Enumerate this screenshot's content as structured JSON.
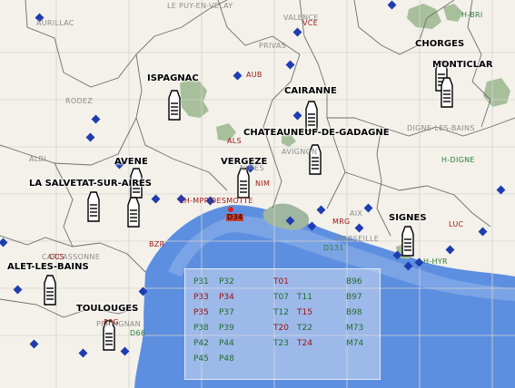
{
  "region_labels": [
    {
      "id": "gray-aurillac",
      "text": "AURILLAC",
      "style": "gray"
    },
    {
      "id": "gray-lepuy",
      "text": "LE PUY-EN-VELAY",
      "style": "gray"
    },
    {
      "id": "gray-valence",
      "text": "VALENCE",
      "style": "gray"
    },
    {
      "id": "gray-privas",
      "text": "PRIVAS",
      "style": "gray"
    },
    {
      "id": "gray-rodez",
      "text": "RODEZ",
      "style": "gray"
    },
    {
      "id": "gray-albi",
      "text": "ALBI",
      "style": "gray"
    },
    {
      "id": "gray-nimes",
      "text": "NIMES",
      "style": "gray"
    },
    {
      "id": "gray-avignon",
      "text": "AVIGNON",
      "style": "gray"
    },
    {
      "id": "gray-digne",
      "text": "DIGNE-LES-BAINS",
      "style": "gray"
    },
    {
      "id": "gray-aix",
      "text": "AIX",
      "style": "gray"
    },
    {
      "id": "gray-marseille",
      "text": "MARSEILLE",
      "style": "gray"
    },
    {
      "id": "gray-carcassonne",
      "text": "CARCASSONNE",
      "style": "gray"
    },
    {
      "id": "gray-perpignan",
      "text": "PERPIGNAN",
      "style": "gray"
    },
    {
      "id": "red-vce",
      "text": "VCE",
      "style": "red"
    },
    {
      "id": "red-aub",
      "text": "AUB",
      "style": "red"
    },
    {
      "id": "red-als",
      "text": "ALS",
      "style": "red"
    },
    {
      "id": "red-nim",
      "text": "NIM",
      "style": "red"
    },
    {
      "id": "red-bzr",
      "text": "BZR",
      "style": "red"
    },
    {
      "id": "red-ccs",
      "text": "CCS",
      "style": "red"
    },
    {
      "id": "red-mrg",
      "text": "MRG",
      "style": "red"
    },
    {
      "id": "red-luc",
      "text": "LUC",
      "style": "red"
    },
    {
      "id": "red-ppg",
      "text": "PPG",
      "style": "red"
    },
    {
      "id": "red-lhmpr",
      "text": "LH-MPR",
      "style": "red"
    },
    {
      "id": "green-hbri",
      "text": "H-BRI",
      "style": "green"
    },
    {
      "id": "green-hdigne",
      "text": "H-DIGNE",
      "style": "green"
    },
    {
      "id": "green-hhyr",
      "text": "H-HYR",
      "style": "green"
    },
    {
      "id": "green-d131",
      "text": "D131",
      "style": "green"
    },
    {
      "id": "green-d66",
      "text": "D66",
      "style": "green"
    }
  ],
  "stations": [
    {
      "id": "ispagnac",
      "name": "ISPAGNAC"
    },
    {
      "id": "cairanne",
      "name": "CAIRANNE"
    },
    {
      "id": "chorges",
      "name": "CHORGES"
    },
    {
      "id": "monticlar",
      "name": "MONTICLAR"
    },
    {
      "id": "chateauneuf",
      "name": "CHATEAUNEUF-DE-GADAGNE"
    },
    {
      "id": "avene",
      "name": "AVENE"
    },
    {
      "id": "vergeze",
      "name": "VERGEZE"
    },
    {
      "id": "la-salvetat",
      "name": "LA SALVETAT-SUR-AIRES"
    },
    {
      "id": "desmotte",
      "name": "DESMOTTE"
    },
    {
      "id": "signes",
      "name": "SIGNES"
    },
    {
      "id": "alet",
      "name": "ALET-LES-BAINS"
    },
    {
      "id": "toulouges",
      "name": "TOULOUGES"
    }
  ],
  "sea_tag": {
    "text": "D34"
  },
  "legend": {
    "columns": [
      [
        {
          "t": "P31",
          "c": "g"
        },
        {
          "t": "P33",
          "c": "r"
        },
        {
          "t": "P35",
          "c": "r"
        },
        {
          "t": "P38",
          "c": "g"
        },
        {
          "t": "P42",
          "c": "g"
        },
        {
          "t": "P45",
          "c": "g"
        }
      ],
      [
        {
          "t": "P32",
          "c": "g"
        },
        {
          "t": "P34",
          "c": "r"
        },
        {
          "t": "P37",
          "c": "g"
        },
        {
          "t": "P39",
          "c": "g"
        },
        {
          "t": "P44",
          "c": "g"
        },
        {
          "t": "P48",
          "c": "g"
        }
      ],
      [
        {
          "t": "T01",
          "c": "r"
        },
        {
          "t": "T07",
          "c": "g"
        },
        {
          "t": "T12",
          "c": "g"
        },
        {
          "t": "T20",
          "c": "r"
        },
        {
          "t": "T23",
          "c": "g"
        }
      ],
      [
        {
          "t": "T11",
          "c": "g"
        },
        {
          "t": "T15",
          "c": "r"
        },
        {
          "t": "T22",
          "c": "g"
        },
        {
          "t": "T24",
          "c": "r"
        }
      ],
      [
        {
          "t": "B96",
          "c": "g"
        },
        {
          "t": "B97",
          "c": "g"
        },
        {
          "t": "B98",
          "c": "g"
        },
        {
          "t": "M73",
          "c": "g"
        },
        {
          "t": "M74",
          "c": "g"
        }
      ]
    ]
  },
  "colors": {
    "land": "#f3f1ea",
    "sea": "#5d8fe0",
    "shallow": "#c9d9f3",
    "forest": "#a7bf9b",
    "marker": "#1f3cb0",
    "region_text": "#8c8c8c",
    "code_text": "#a01818"
  }
}
